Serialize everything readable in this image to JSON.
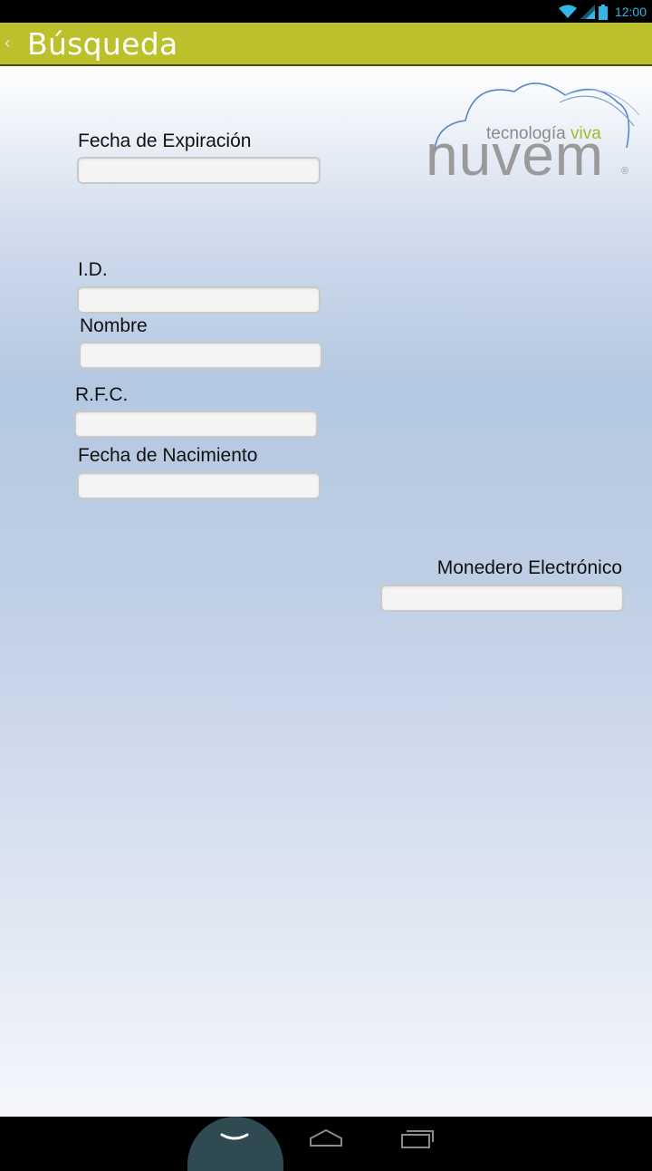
{
  "status_bar": {
    "time": "12:00",
    "icons": [
      "wifi-icon",
      "signal-icon",
      "battery-icon"
    ]
  },
  "action_bar": {
    "title": "Búsqueda",
    "back_icon": "chevron-left-icon",
    "color": "#bcc12b"
  },
  "logo": {
    "tagline_part1": "tecnología",
    "tagline_part2": "viva",
    "brand": "nuvem",
    "registered": "®"
  },
  "form": {
    "fields": [
      {
        "label": "Fecha de Expiración",
        "value": ""
      },
      {
        "label": "I.D.",
        "value": ""
      },
      {
        "label": "Nombre",
        "value": ""
      },
      {
        "label": "R.F.C.",
        "value": ""
      },
      {
        "label": "Fecha de Nacimiento",
        "value": ""
      },
      {
        "label": "Monedero Electrónico",
        "value": ""
      }
    ]
  },
  "nav_bar": {
    "buttons": [
      "hide-keyboard-icon",
      "home-icon",
      "recent-apps-icon"
    ]
  }
}
